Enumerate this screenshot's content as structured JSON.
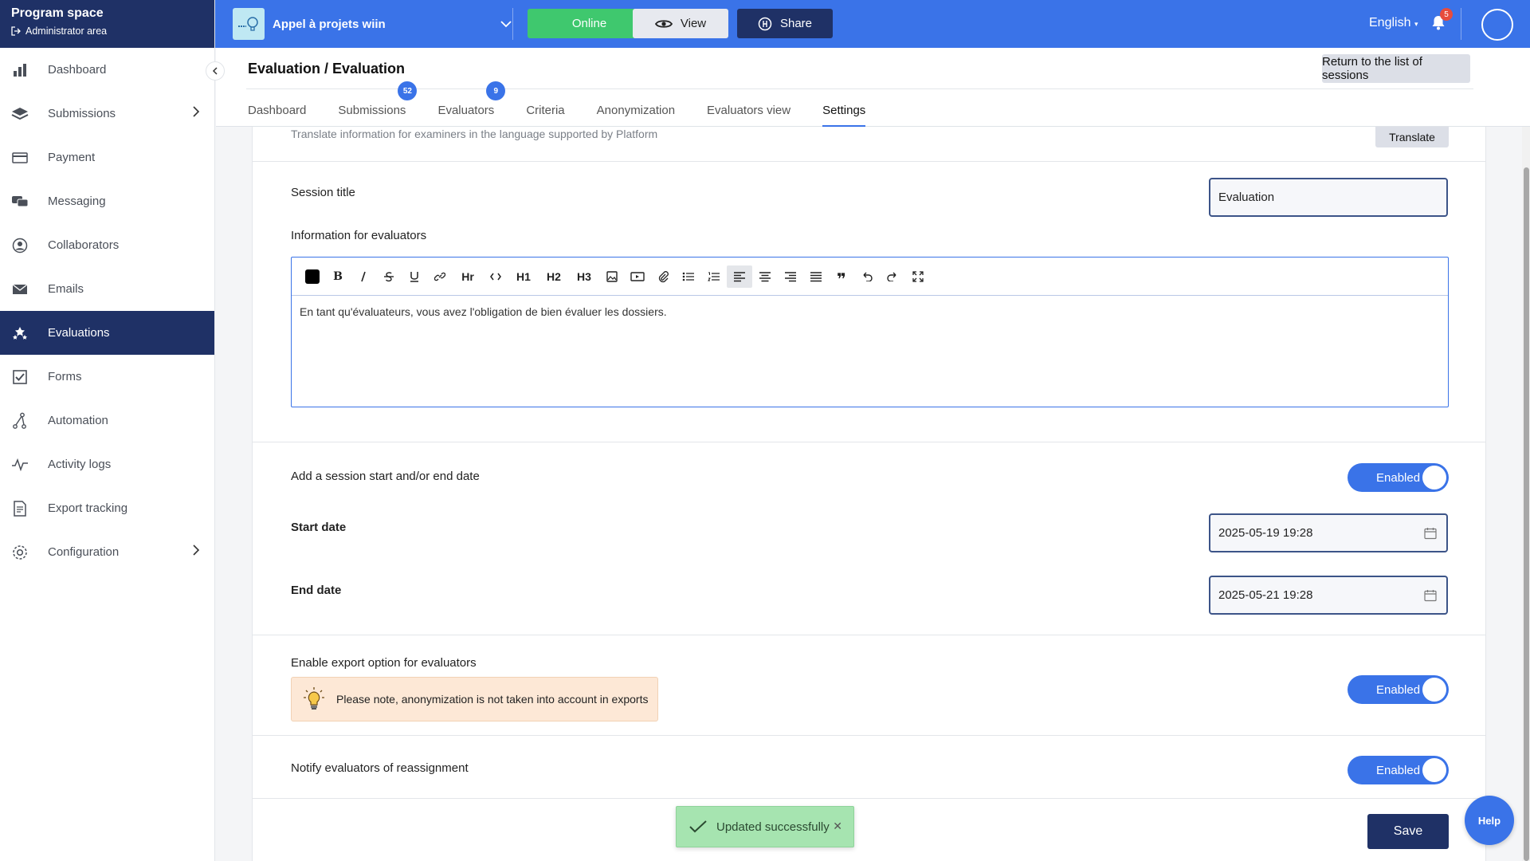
{
  "sidebar": {
    "title": "Program space",
    "admin_link": "Administrator area",
    "items": [
      {
        "label": "Dashboard",
        "icon": "bar-chart-icon"
      },
      {
        "label": "Submissions",
        "icon": "layers-icon"
      },
      {
        "label": "Payment",
        "icon": "credit-card-icon"
      },
      {
        "label": "Messaging",
        "icon": "chat-icon"
      },
      {
        "label": "Collaborators",
        "icon": "user-circle-icon"
      },
      {
        "label": "Emails",
        "icon": "envelope-icon"
      },
      {
        "label": "Evaluations",
        "icon": "stars-icon"
      },
      {
        "label": "Forms",
        "icon": "checkbox-icon"
      },
      {
        "label": "Automation",
        "icon": "automation-icon"
      },
      {
        "label": "Activity logs",
        "icon": "activity-icon"
      },
      {
        "label": "Export tracking",
        "icon": "document-icon"
      },
      {
        "label": "Configuration",
        "icon": "gear-icon"
      }
    ]
  },
  "topbar": {
    "program_name": "Appel à projets wiin",
    "online_label": "Online",
    "view_label": "View",
    "share_label": "Share",
    "language": "English",
    "notification_count": "5"
  },
  "page": {
    "title": "Evaluation / Evaluation",
    "return_label": "Return to the list of sessions",
    "tabs": [
      {
        "label": "Dashboard"
      },
      {
        "label": "Submissions",
        "badge": "52"
      },
      {
        "label": "Evaluators",
        "badge": "9"
      },
      {
        "label": "Criteria"
      },
      {
        "label": "Anonymization"
      },
      {
        "label": "Evaluators view"
      },
      {
        "label": "Settings"
      }
    ]
  },
  "settings": {
    "translate_info": "Translate information for examiners in the language supported by Platform",
    "translate_label": "Translate",
    "session_title_label": "Session title",
    "session_title_value": "Evaluation",
    "info_label": "Information for evaluators",
    "editor_text": "En tant qu'évaluateurs, vous avez l'obligation de bien évaluer les dossiers.",
    "toolbar": {
      "hr": "Hr",
      "h1": "H1",
      "h2": "H2",
      "h3": "H3"
    },
    "date_toggle_label": "Add a session start and/or end date",
    "enabled_label": "Enabled",
    "start_date_label": "Start date",
    "start_date_value": "2025-05-19 19:28",
    "end_date_label": "End date",
    "end_date_value": "2025-05-21 19:28",
    "export_label": "Enable export option for evaluators",
    "export_note": "Please note, anonymization is not taken into account in exports",
    "notify_label": "Notify evaluators of reassignment",
    "save_label": "Save"
  },
  "toast": {
    "message": "Updated successfully"
  },
  "help_label": "Help",
  "colors": {
    "primary": "#3a73e8",
    "navy": "#1f3166",
    "online_green": "#3fc86e",
    "toast_green": "#a6e4b0",
    "note_bg": "#fde8d6"
  }
}
